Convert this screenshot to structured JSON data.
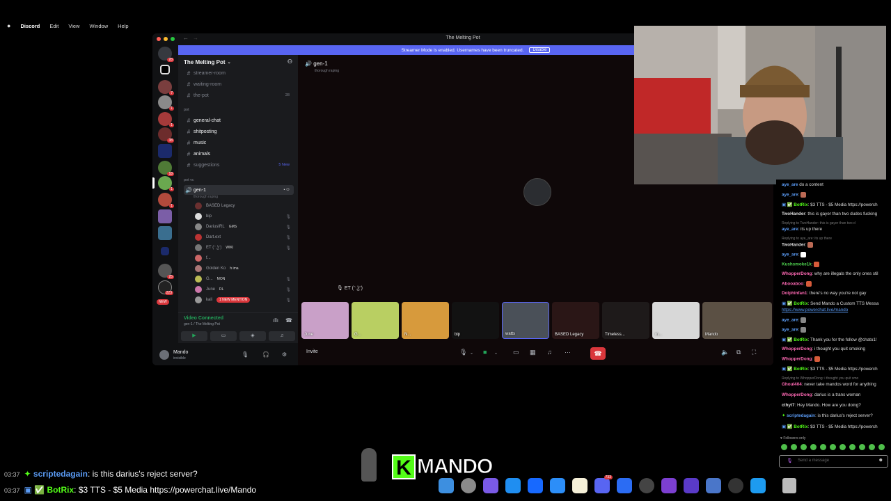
{
  "menubar": {
    "app": "Discord",
    "items": [
      "Edit",
      "View",
      "Window",
      "Help"
    ]
  },
  "window": {
    "title": "The Melting Pot",
    "banner": "Streamer Mode is enabled. Usernames have been truncated.",
    "banner_button": "Disable"
  },
  "server": {
    "name": "The Melting Pot",
    "channels_top": [
      {
        "name": "streamer-room"
      },
      {
        "name": "waiting-room"
      },
      {
        "name": "the-pot",
        "extra": "28"
      }
    ],
    "category_pot": "pot",
    "channels_pot": [
      {
        "name": "general-chat"
      },
      {
        "name": "shitposting"
      },
      {
        "name": "music"
      },
      {
        "name": "animals"
      },
      {
        "name": "suggestions",
        "extra": "5 New"
      }
    ],
    "category_vc": "pot vc",
    "voice_channel": "gen-1",
    "voice_sub": "thorough raping",
    "members": [
      {
        "name": "BASED Legacy",
        "tag": ""
      },
      {
        "name": "bip",
        "tag": ""
      },
      {
        "name": "DariusIRL",
        "tag": "GMS"
      },
      {
        "name": "Dart.ext",
        "tag": ""
      },
      {
        "name": "ET (ᵔ ͜ʖᵔ)",
        "tag": "WIKI"
      },
      {
        "name": "f...",
        "tag": ""
      },
      {
        "name": "Golden Ko",
        "tag": "h ima"
      },
      {
        "name": "G...",
        "tag": "MON"
      },
      {
        "name": "June",
        "tag": "DL"
      },
      {
        "name": "kali",
        "tag": ""
      }
    ],
    "new_mention": "1 NEW MENTION"
  },
  "voice": {
    "status": "Video Connected",
    "location": "gen-1 / The Melting Pot"
  },
  "user": {
    "name": "Mando",
    "status": "invisible"
  },
  "stage": {
    "channel": "gen-1",
    "subtitle": "thorough raping",
    "speaking": "ET (ᵔ ͜ʖᵔ)",
    "invite": "Invite",
    "tiles": [
      "June",
      "G...",
      "N...",
      "bip",
      "watts",
      "BASED Legacy",
      "Timeless...",
      "m...",
      "Mando"
    ]
  },
  "chat": {
    "lines": [
      {
        "user": "aye_are",
        "color": "#5b9cf6",
        "text": " do a content"
      },
      {
        "user": "aye_are",
        "color": "#5b9cf6",
        "text": ":",
        "emote": true
      },
      {
        "user": "BotRix",
        "color": "#53fc18",
        "text": ": $3 TTS - $5 Media https://powerch"
      },
      {
        "user": "TwoHander",
        "color": "#dddddd",
        "text": ": this is gayer than two dudes fucking"
      },
      {
        "reply": "Replying to TwoHander: this is gayer than two d"
      },
      {
        "user": "aye_are",
        "color": "#5b9cf6",
        "text": ": its up there"
      },
      {
        "reply": "Replying to aye_are: its up there"
      },
      {
        "user": "TwoHander",
        "color": "#dddddd",
        "text": ":",
        "emote": true
      },
      {
        "user": "aye_are",
        "color": "#5b9cf6",
        "text": ":",
        "emote": true
      },
      {
        "user": "Kushsmoke1k",
        "color": "#4fd34f",
        "text": ":",
        "emote": true
      },
      {
        "user": "WhopperDong",
        "color": "#ff69b4",
        "text": ": why are illegals the only ones stil"
      },
      {
        "user": "Abooaboo",
        "color": "#ff69b4",
        "text": ":",
        "emote": true
      },
      {
        "user": "Dolphinfan1",
        "color": "#ff69b4",
        "text": ": there's no way you're not gay"
      },
      {
        "user": "BotRix",
        "color": "#53fc18",
        "text": ": Send Mando a Custom TTS Messa"
      },
      {
        "plain": "https://www.powerchat.live/mando"
      },
      {
        "user": "aye_are",
        "color": "#5b9cf6",
        "text": ":",
        "emote": true
      },
      {
        "user": "aye_are",
        "color": "#5b9cf6",
        "text": ":",
        "emote": true
      },
      {
        "user": "BotRix",
        "color": "#53fc18",
        "text": ": Thank you for the follow @chato1!"
      },
      {
        "user": "WhopperDong",
        "color": "#ff69b4",
        "text": ": i thought you quit smoking"
      },
      {
        "user": "WhopperDong",
        "color": "#ff69b4",
        "text": ":",
        "emote": true
      },
      {
        "user": "BotRix",
        "color": "#53fc18",
        "text": ": $3 TTS - $5 Media https://powerch"
      },
      {
        "reply": "Replying to WhopperDong: i thought you quit smo"
      },
      {
        "user": "Ghoul404",
        "color": "#ff69b4",
        "text": ": never take mandos word for anything"
      },
      {
        "user": "WhopperDong",
        "color": "#ff69b4",
        "text": ": darius is a trans woman"
      },
      {
        "user": "cthyt7",
        "color": "#dddddd",
        "text": ": Hey Mando. How are you doing?"
      },
      {
        "user": "scriptedagain",
        "color": "#5b9cf6",
        "text": ": is this darius's reject server?"
      },
      {
        "user": "BotRix",
        "color": "#53fc18",
        "text": ": $3 TTS - $5 Media https://powerch"
      }
    ],
    "followers_only": "Followers only",
    "placeholder": "Send a message"
  },
  "overlay": {
    "line1": {
      "time": "03:37",
      "user": "scriptedagain",
      "text": ": is this darius's reject server?"
    },
    "line2": {
      "time": "03:37",
      "user": "BotRix",
      "text": ": $3 TTS - $5 Media https://powerchat.live/Mando"
    },
    "logo_k": "K",
    "logo_text": "MANDO"
  },
  "dock": {
    "discord_badge": "733"
  },
  "colors": {
    "accent": "#5865f2",
    "kick_green": "#53fc18",
    "danger": "#da373c"
  }
}
